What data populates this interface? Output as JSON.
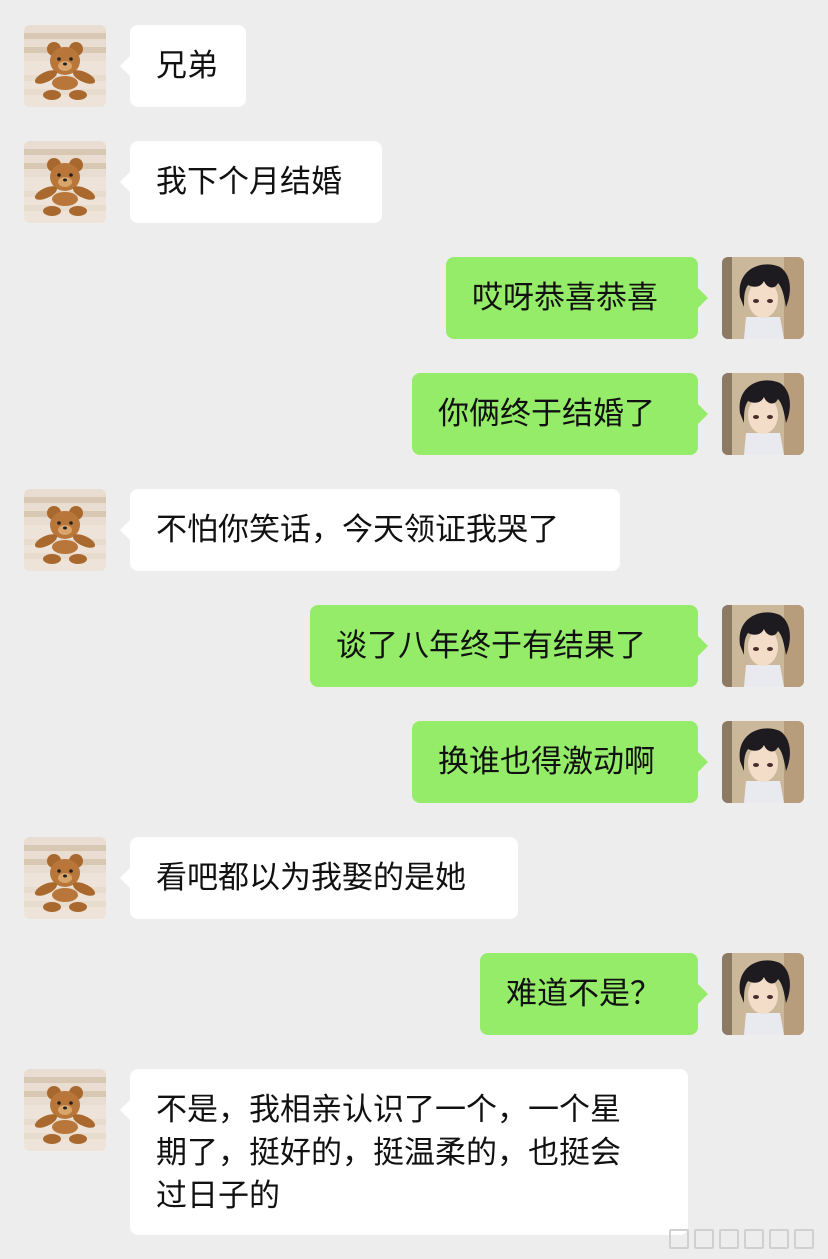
{
  "colors": {
    "background": "#ededed",
    "incoming_bubble": "#ffffff",
    "outgoing_bubble": "#95ec69"
  },
  "messages": [
    {
      "side": "left",
      "avatar": "teddy-bear-avatar",
      "text": "兄弟"
    },
    {
      "side": "left",
      "avatar": "teddy-bear-avatar",
      "text": "我下个月结婚"
    },
    {
      "side": "right",
      "avatar": "anime-boy-avatar",
      "text": "哎呀恭喜恭喜"
    },
    {
      "side": "right",
      "avatar": "anime-boy-avatar",
      "text": "你俩终于结婚了"
    },
    {
      "side": "left",
      "avatar": "teddy-bear-avatar",
      "text": "不怕你笑话，今天领证我哭了"
    },
    {
      "side": "right",
      "avatar": "anime-boy-avatar",
      "text": "谈了八年终于有结果了"
    },
    {
      "side": "right",
      "avatar": "anime-boy-avatar",
      "text": "换谁也得激动啊"
    },
    {
      "side": "left",
      "avatar": "teddy-bear-avatar",
      "text": "看吧都以为我娶的是她"
    },
    {
      "side": "right",
      "avatar": "anime-boy-avatar",
      "text": "难道不是？"
    },
    {
      "side": "left",
      "avatar": "teddy-bear-avatar",
      "text": "不是，我相亲认识了一个，一个星\n期了，挺好的，挺温柔的，也挺会\n过日子的"
    }
  ]
}
